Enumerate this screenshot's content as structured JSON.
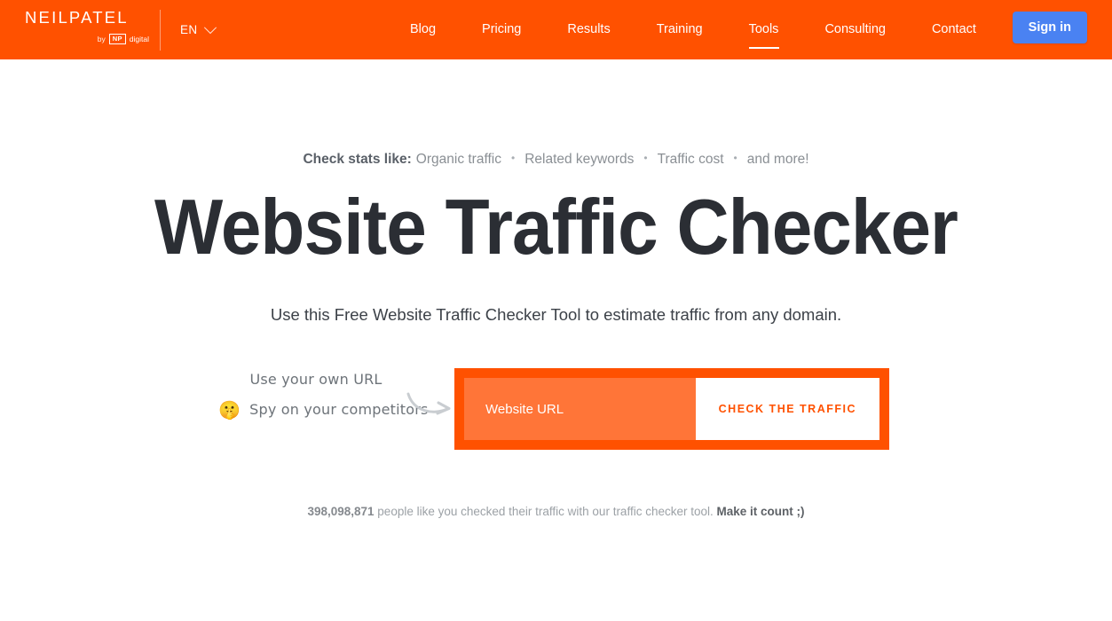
{
  "colors": {
    "brand_orange": "#ff5100",
    "input_orange": "#ff7538",
    "signin_blue": "#4a82f2",
    "heading_dark": "#2b2e34",
    "muted_gray": "#8a8f94"
  },
  "header": {
    "logo": {
      "wordmark": "NEILPATEL",
      "by_label": "by",
      "np_mark": "NP",
      "digital_label": "digital"
    },
    "language": {
      "value": "EN",
      "icon": "chevron-down-icon"
    },
    "nav": [
      {
        "label": "Blog",
        "active": false
      },
      {
        "label": "Pricing",
        "active": false
      },
      {
        "label": "Results",
        "active": false
      },
      {
        "label": "Training",
        "active": false
      },
      {
        "label": "Tools",
        "active": true
      },
      {
        "label": "Consulting",
        "active": false
      },
      {
        "label": "Contact",
        "active": false
      }
    ],
    "signin_label": "Sign in"
  },
  "hero": {
    "stats": {
      "label": "Check stats like:",
      "items": [
        "Organic traffic",
        "Related keywords",
        "Traffic cost",
        "and more!"
      ],
      "separator": "•"
    },
    "title": "Website Traffic Checker",
    "subtitle": "Use this Free Website Traffic Checker Tool to estimate traffic from any domain."
  },
  "annotations": {
    "line1": "Use your own URL",
    "line2": "Spy on your competitors",
    "emoji": "🤫",
    "emoji_name": "shushing-face-emoji",
    "arrow_name": "curved-arrow-icon"
  },
  "search": {
    "placeholder": "Website URL",
    "value": "",
    "button_label": "CHECK THE TRAFFIC"
  },
  "counter": {
    "count": "398,098,871",
    "text": " people like you checked their traffic with our traffic checker tool.",
    "cta": "Make it count ;)"
  }
}
